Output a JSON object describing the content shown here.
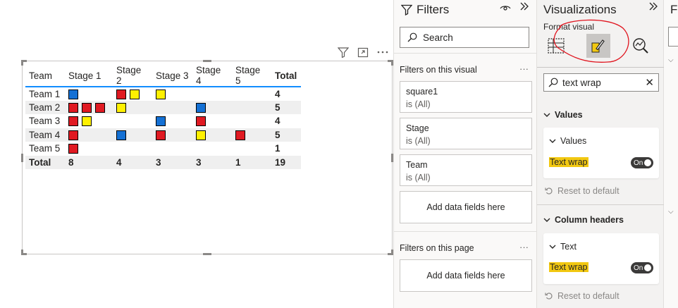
{
  "matrix": {
    "headers": [
      "Team",
      "Stage 1",
      "Stage 2",
      "Stage 3",
      "Stage 4",
      "Stage 5",
      "Total"
    ],
    "rows": [
      {
        "team": "Team 1",
        "stages": [
          [
            "blue"
          ],
          [
            "red",
            "yellow"
          ],
          [
            "yellow"
          ],
          [],
          []
        ],
        "total": "4"
      },
      {
        "team": "Team 2",
        "stages": [
          [
            "red",
            "red",
            "red"
          ],
          [
            "yellow"
          ],
          [],
          [
            "blue"
          ],
          []
        ],
        "total": "5"
      },
      {
        "team": "Team 3",
        "stages": [
          [
            "red",
            "yellow"
          ],
          [],
          [
            "blue"
          ],
          [
            "red"
          ],
          []
        ],
        "total": "4"
      },
      {
        "team": "Team 4",
        "stages": [
          [
            "red"
          ],
          [
            "blue"
          ],
          [
            "red"
          ],
          [
            "yellow"
          ],
          [
            "red"
          ]
        ],
        "total": "5"
      },
      {
        "team": "Team 5",
        "stages": [
          [
            "red"
          ],
          [],
          [],
          [],
          []
        ],
        "total": "1"
      }
    ],
    "totals": [
      "Total",
      "8",
      "4",
      "3",
      "3",
      "1",
      "19"
    ],
    "colors": {
      "blue": "#1470d4",
      "red": "#e01a22",
      "yellow": "#fff000"
    }
  },
  "filters": {
    "title": "Filters",
    "search_placeholder": "Search",
    "on_visual_label": "Filters on this visual",
    "cards": [
      {
        "field": "square1",
        "value": "is (All)"
      },
      {
        "field": "Stage",
        "value": "is (All)"
      },
      {
        "field": "Team",
        "value": "is (All)"
      }
    ],
    "add_fields_label": "Add data fields here",
    "on_page_label": "Filters on this page",
    "add_fields_page_label": "Add data fields here"
  },
  "viz": {
    "title": "Visualizations",
    "subtitle": "Format visual",
    "search_value": "text wrap",
    "values_group": "Values",
    "values_card_title": "Values",
    "values_option": "Text wrap",
    "values_toggle": "On",
    "reset_1": "Reset to default",
    "column_headers_group": "Column headers",
    "text_card_title": "Text",
    "text_option": "Text wrap",
    "text_toggle": "On",
    "reset_2": "Reset to default",
    "accent_color": "#f2c811"
  },
  "fields": {
    "title": "Fi"
  }
}
